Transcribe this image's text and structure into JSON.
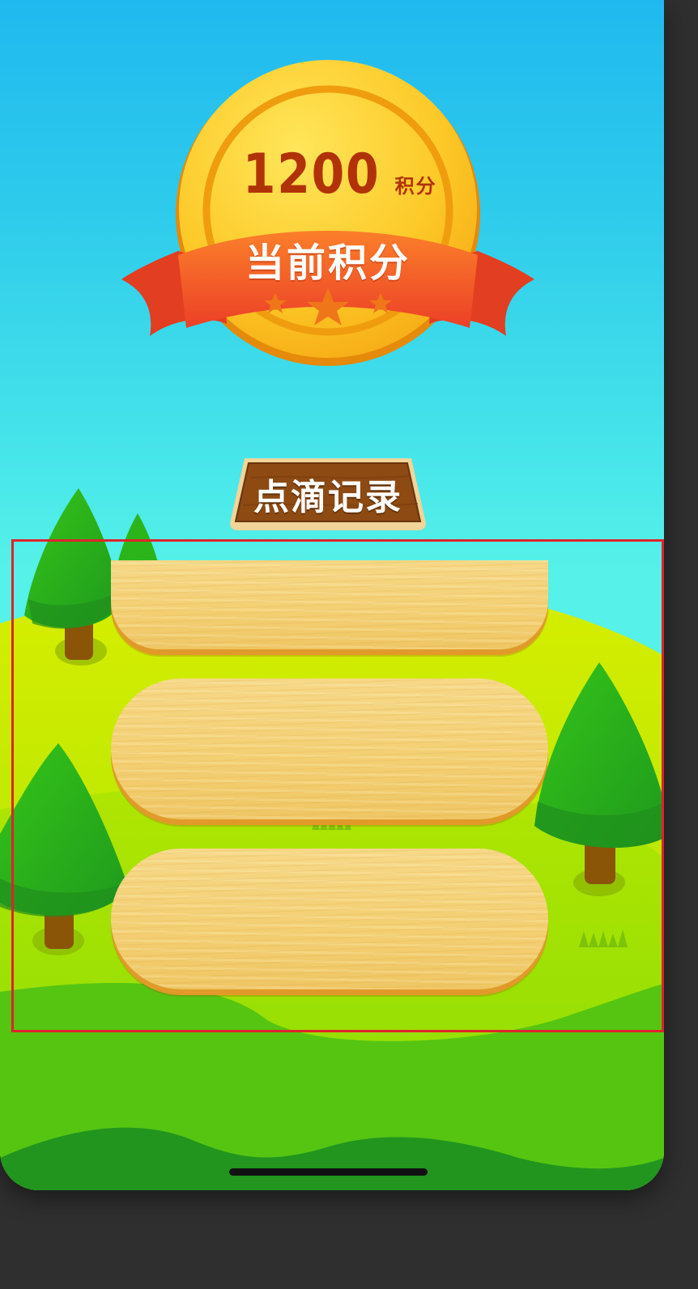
{
  "score": {
    "value": "1200",
    "unit": "积分",
    "ribbon_label": "当前积分"
  },
  "records_section": {
    "title": "点滴记录",
    "items": [
      {
        "label": ""
      },
      {
        "label": ""
      },
      {
        "label": ""
      }
    ]
  },
  "colors": {
    "sky_top": "#20b9ef",
    "sky_bottom": "#56f1e8",
    "grass_light": "#c8ea00",
    "grass_mid": "#5cc80e",
    "grass_dark": "#22951f",
    "coin_gold": "#fbc82a",
    "ribbon_red": "#ea4b2a",
    "wood_card": "#f3cf72",
    "sign_wood": "#8a4a14",
    "highlight_border": "#e0232c"
  },
  "icons": [
    "coin-icon",
    "ribbon-icon",
    "star-icon",
    "tree-icon",
    "grass-icon"
  ]
}
